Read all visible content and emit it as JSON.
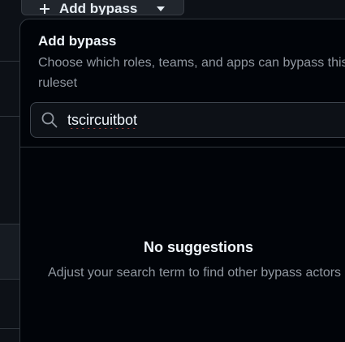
{
  "trigger": {
    "label": "Add bypass"
  },
  "panel": {
    "title": "Add bypass",
    "description": "Choose which roles, teams, and apps can bypass this ruleset"
  },
  "search": {
    "value": "tscircuitbot",
    "icon": "search-icon"
  },
  "empty_state": {
    "title": "No suggestions",
    "description": "Adjust your search term to find other bypass actors"
  },
  "colors": {
    "panel_bg": "#010409",
    "page_bg": "#0d1117",
    "border": "#30363d",
    "muted_text": "#9198a1",
    "spell_underline": "#e5534b"
  }
}
